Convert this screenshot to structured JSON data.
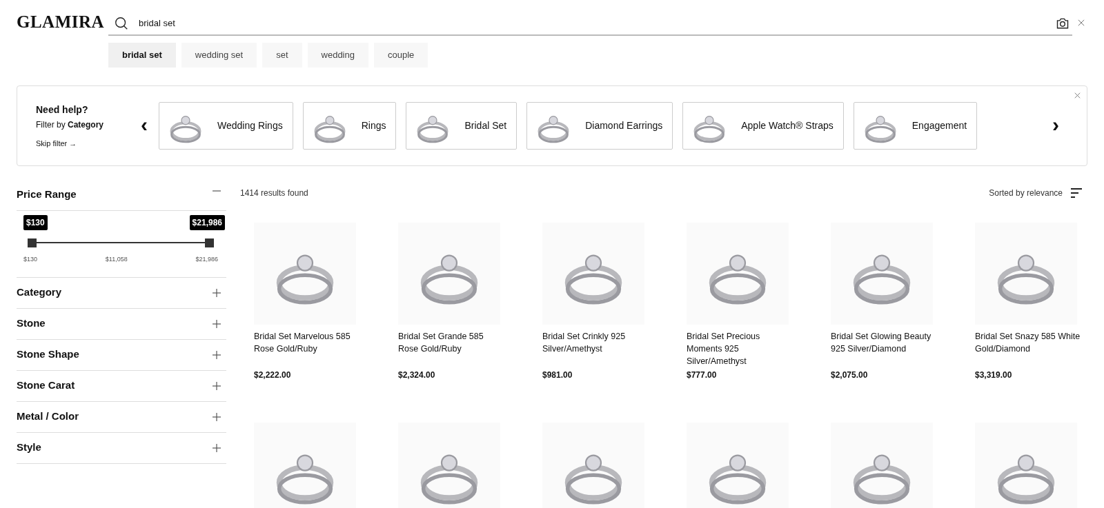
{
  "header": {
    "logo": "GLAMIRA",
    "search": {
      "value": "bridal set"
    }
  },
  "suggestions": [
    {
      "label": "bridal set",
      "selected": true
    },
    {
      "label": "wedding set",
      "selected": false
    },
    {
      "label": "set",
      "selected": false
    },
    {
      "label": "wedding",
      "selected": false
    },
    {
      "label": "couple",
      "selected": false
    }
  ],
  "category_panel": {
    "title": "Need help?",
    "subtitle": "Filter by **Category**",
    "skip": "Skip filter →",
    "prev": "‹",
    "next": "›",
    "categories": [
      {
        "label": "Wedding Rings"
      },
      {
        "label": "Rings"
      },
      {
        "label": "Bridal Set"
      },
      {
        "label": "Diamond Earrings"
      },
      {
        "label": "Apple Watch® Straps"
      },
      {
        "label": "Engagement"
      }
    ]
  },
  "filters": [
    {
      "title": "Price Range",
      "expanded": true
    },
    {
      "title": "Category",
      "expanded": false
    },
    {
      "title": "Stone",
      "expanded": false
    },
    {
      "title": "Stone Shape",
      "expanded": false
    },
    {
      "title": "Stone Carat",
      "expanded": false
    },
    {
      "title": "Metal / Color",
      "expanded": false
    },
    {
      "title": "Style",
      "expanded": false
    }
  ],
  "price_slider": {
    "thumbs": [
      {
        "label": "$130",
        "level": 0
      },
      {
        "label": "$21,986",
        "level": 1
      }
    ],
    "scale": [
      "$130",
      "$11,058",
      "$21,986"
    ]
  },
  "results": {
    "count": "1414 results found",
    "sort": "Sorted by relevance"
  },
  "products": [
    {
      "kind": "full",
      "name": "Bridal Set Marvelous 585 Rose Gold/Ruby",
      "price": "$2,222.00"
    },
    {
      "kind": "full",
      "name": "Bridal Set Grande 585 Rose Gold/Ruby",
      "price": "$2,324.00"
    },
    {
      "kind": "full",
      "name": "Bridal Set Crinkly 925 Silver/Amethyst",
      "price": "$981.00"
    },
    {
      "kind": "full",
      "name": "Bridal Set Precious Moments 925 Silver/Amethyst",
      "price": "$777.00"
    },
    {
      "kind": "full",
      "name": "Bridal Set Glowing Beauty 925 Silver/Diamond",
      "price": "$2,075.00"
    },
    {
      "kind": "full",
      "name": "Bridal Set Snazy 585 White Gold/Diamond",
      "price": "$3,319.00"
    },
    {
      "kind": "photo_only"
    },
    {
      "kind": "photo_only"
    },
    {
      "kind": "photo_only"
    },
    {
      "kind": "photo_only"
    },
    {
      "kind": "photo_only"
    },
    {
      "kind": "photo_only"
    }
  ]
}
